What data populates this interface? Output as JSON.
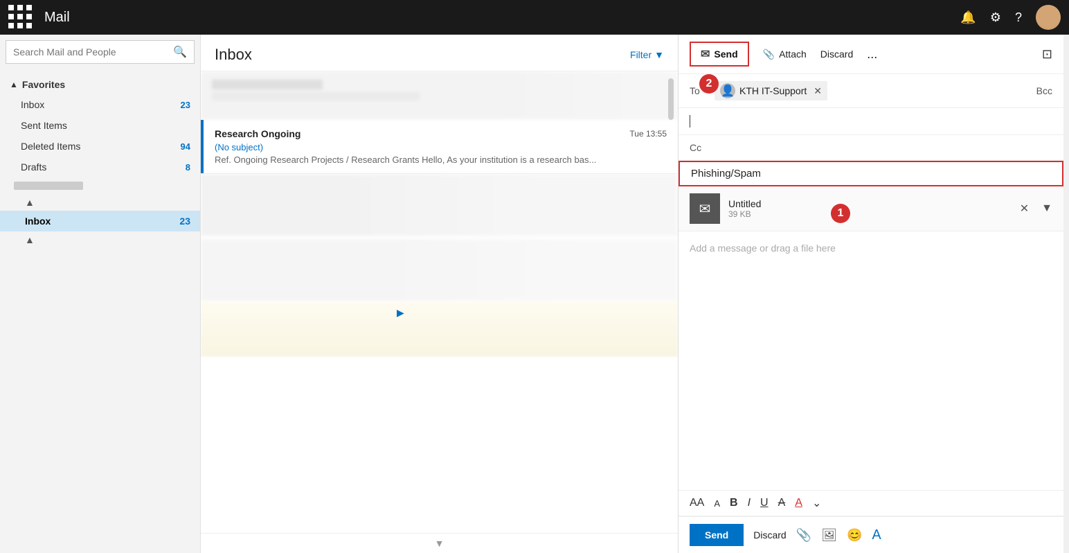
{
  "app": {
    "title": "Mail",
    "grid_label": "App launcher"
  },
  "topbar": {
    "title": "Mail",
    "bell_label": "Notifications",
    "gear_label": "Settings",
    "help_label": "Help",
    "avatar_label": "User profile"
  },
  "search": {
    "placeholder": "Search Mail and People"
  },
  "sidebar": {
    "favorites_label": "Favorites",
    "favorites_expanded": true,
    "items": [
      {
        "label": "Inbox",
        "badge": "23",
        "active": false
      },
      {
        "label": "Sent Items",
        "badge": "",
        "active": false
      },
      {
        "label": "Deleted Items",
        "badge": "94",
        "active": false
      },
      {
        "label": "Drafts",
        "badge": "8",
        "active": false
      }
    ],
    "section2_label": "",
    "inbox_label": "Inbox",
    "inbox_badge": "23"
  },
  "email_list": {
    "title": "Inbox",
    "filter_label": "Filter",
    "emails": [
      {
        "sender": "Research Ongoing",
        "subject": "(No subject)",
        "preview": "Ref. Ongoing Research Projects / Research Grants Hello, As your institution is a research bas...",
        "time": "Tue 13:55",
        "has_blue_bar": true
      }
    ]
  },
  "compose": {
    "toolbar": {
      "send_label": "Send",
      "attach_label": "Attach",
      "discard_label": "Discard",
      "more_label": "...",
      "expand_label": "⊡"
    },
    "to_label": "To",
    "recipient": "KTH IT-Support",
    "bcc_label": "Bcc",
    "cc_label": "Cc",
    "subject": "Phishing/Spam",
    "attachment": {
      "name": "Untitled",
      "size": "39 KB"
    },
    "message_placeholder": "Add a message or drag a file here",
    "send_label": "Send",
    "discard_label": "Discard",
    "formatting": {
      "font_size_large": "AA",
      "font_size_small": "A",
      "bold": "B",
      "italic": "I",
      "underline": "U",
      "strikethrough": "A̶",
      "font_color": "A",
      "more": "⌄"
    }
  },
  "badges": {
    "badge1": "1",
    "badge2": "2"
  }
}
